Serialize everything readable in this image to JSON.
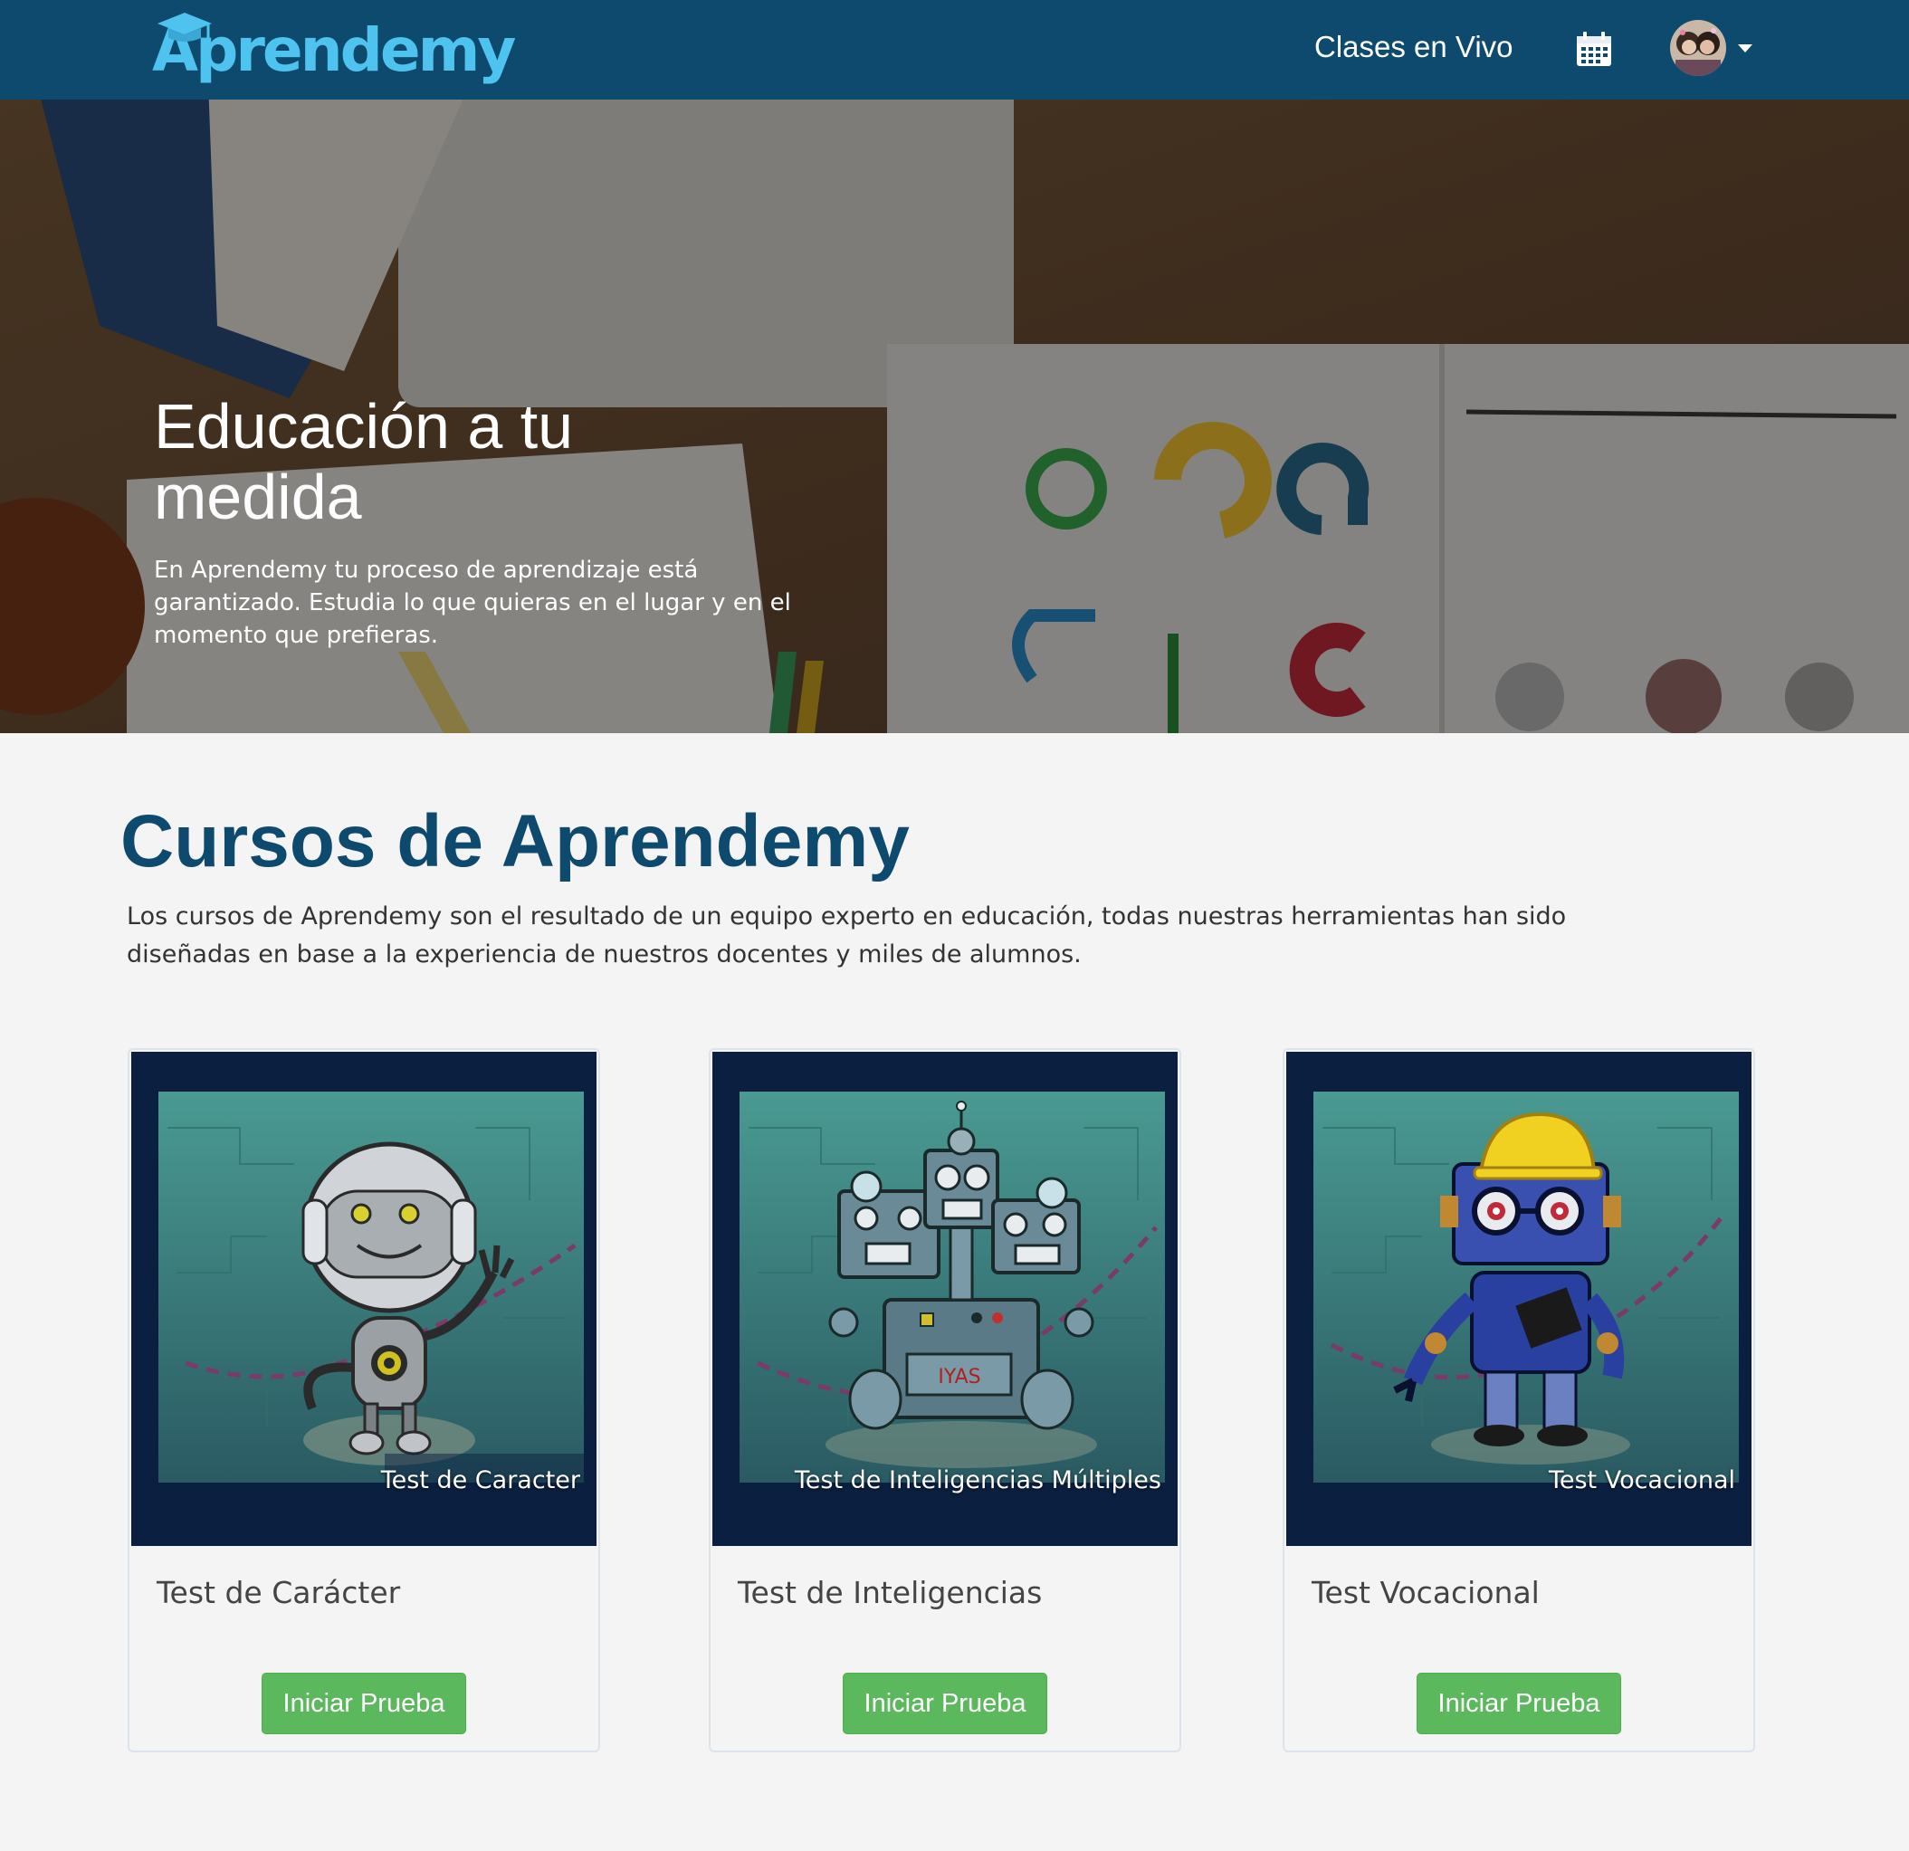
{
  "navbar": {
    "logo_text": "Aprendemy",
    "live_classes_label": "Clases en Vivo",
    "calendar_icon": "calendar-icon",
    "avatar_icon": "user-avatar",
    "dropdown_icon": "caret-down-icon"
  },
  "hero": {
    "title": "Educación a tu medida",
    "text": "En Aprendemy tu proceso de aprendizaje está garantizado. Estudia lo que quieras en el lugar y en el momento que prefieras."
  },
  "courses": {
    "title": "Cursos de Aprendemy",
    "description": "Los cursos de Aprendemy son el resultado de un equipo experto en educación, todas nuestras herramientas han sido diseñadas en base a la experiencia de nuestros  docentes y miles de alumnos.",
    "items": [
      {
        "caption": "Test de Caracter",
        "title": "Test de Carácter",
        "button_label": "Iniciar Prueba"
      },
      {
        "caption": "Test de Inteligencias Múltiples",
        "title": "Test de Inteligencias",
        "button_label": "Iniciar Prueba"
      },
      {
        "caption": "Test Vocacional",
        "title": "Test Vocacional",
        "button_label": "Iniciar Prueba"
      }
    ]
  },
  "colors": {
    "navbar": "#0d4a6e",
    "logo": "#4fc3f0",
    "section_title": "#0d4a6e",
    "button": "#5cb85c",
    "card_media": "#0b2040",
    "card_art_teal": "#3e8f89"
  }
}
